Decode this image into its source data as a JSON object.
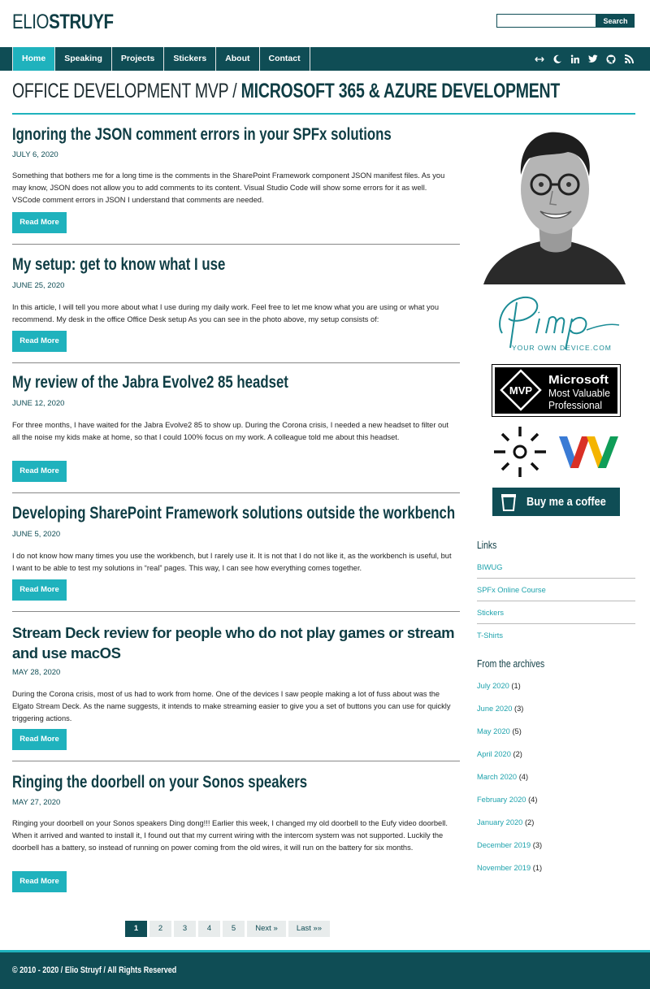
{
  "site": {
    "logo_light": "ELIO",
    "logo_bold": "STRUYF",
    "search_placeholder": "",
    "search_button": "Search"
  },
  "nav": {
    "items": [
      {
        "label": "Home",
        "active": true
      },
      {
        "label": "Speaking",
        "active": false
      },
      {
        "label": "Projects",
        "active": false
      },
      {
        "label": "Stickers",
        "active": false
      },
      {
        "label": "About",
        "active": false
      },
      {
        "label": "Contact",
        "active": false
      }
    ],
    "icons": [
      "arrows-icon",
      "moon-icon",
      "linkedin-icon",
      "twitter-icon",
      "github-icon",
      "rss-icon"
    ]
  },
  "header": {
    "title_light": "OFFICE DEVELOPMENT MVP / ",
    "title_bold": "MICROSOFT 365 & AZURE DEVELOPMENT"
  },
  "posts": [
    {
      "title": "Ignoring the JSON comment errors in your SPFx solutions",
      "date": "JULY 6, 2020",
      "excerpt": "Something that bothers me for a long time is the comments in the SharePoint Framework component JSON manifest files. As you may know, JSON does not allow you to add comments to its content. Visual Studio Code will show some errors for it as well. VSCode comment errors in JSON I understand that comments are needed.",
      "read_more": "Read More"
    },
    {
      "title": "My setup: get to know what I use",
      "date": "JUNE 25, 2020",
      "excerpt": "In this article, I will tell you more about what I use during my daily work. Feel free to let me know what you are using or what you recommend. My desk in the office Office Desk setup As you can see in the photo above, my setup consists of:",
      "read_more": "Read More"
    },
    {
      "title": "My review of the Jabra Evolve2 85 headset",
      "date": "JUNE 12, 2020",
      "excerpt": "For three months, I have waited for the Jabra Evolve2 85 to show up. During the Corona crisis, I needed a new headset to filter out all the noise my kids make at home, so that I could 100% focus on my work. A colleague told me about this headset.",
      "read_more": "Read More"
    },
    {
      "title": "Developing SharePoint Framework solutions outside the workbench",
      "date": "JUNE 5, 2020",
      "excerpt": "I do not know how many times you use the workbench, but I rarely use it. It is not that I do not like it, as the workbench is useful, but I want to be able to test my solutions in “real” pages. This way, I can see how everything comes together.",
      "read_more": "Read More"
    },
    {
      "title": "Stream Deck review for people who do not play games or stream and use macOS",
      "date": "MAY 28, 2020",
      "excerpt": "During the Corona crisis, most of us had to work from home. One of the devices I saw people making a lot of fuss about was the Elgato Stream Deck. As the name suggests, it intends to make streaming easier to give you a set of buttons you can use for quickly triggering actions.",
      "read_more": "Read More"
    },
    {
      "title": "Ringing the doorbell on your Sonos speakers",
      "date": "MAY 27, 2020",
      "excerpt": "Ringing your doorbell on your Sonos speakers Ding dong!!! Earlier this week, I changed my old doorbell to the Eufy video doorbell. When it arrived and wanted to install it, I found out that my current wiring with the intercom system was not supported. Luckily the doorbell has a battery, so instead of running on power coming from the old wires, it will run on the battery for six months.",
      "read_more": "Read More"
    }
  ],
  "pagination": {
    "current": "1",
    "pages": [
      "2",
      "3",
      "4",
      "5"
    ],
    "next": "Next »",
    "last": "Last »»"
  },
  "sidebar": {
    "pimp_logo_text": "Pimp",
    "pimp_tagline": "YOUR OWN DEVICE.COM",
    "mvp_microsoft": "Microsoft",
    "mvp_line1": "Most Valuable",
    "mvp_line2": "Professional",
    "mvp_short": "MVP",
    "coffee_label": "Buy me a coffee",
    "links_title": "Links",
    "links": [
      "BIWUG",
      "SPFx Online Course",
      "Stickers",
      "T-Shirts"
    ],
    "archives_title": "From the archives",
    "archives": [
      {
        "label": "July 2020",
        "count": "(1)"
      },
      {
        "label": "June 2020",
        "count": "(3)"
      },
      {
        "label": "May 2020",
        "count": "(5)"
      },
      {
        "label": "April 2020",
        "count": "(2)"
      },
      {
        "label": "March 2020",
        "count": "(4)"
      },
      {
        "label": "February 2020",
        "count": "(4)"
      },
      {
        "label": "January 2020",
        "count": "(2)"
      },
      {
        "label": "December 2019",
        "count": "(3)"
      },
      {
        "label": "November 2019",
        "count": "(1)"
      }
    ]
  },
  "footer": {
    "text": "© 2010 - 2020 / Elio Struyf / All Rights Reserved"
  },
  "colors": {
    "primary": "#0f4d55",
    "accent": "#1fb2bd"
  }
}
